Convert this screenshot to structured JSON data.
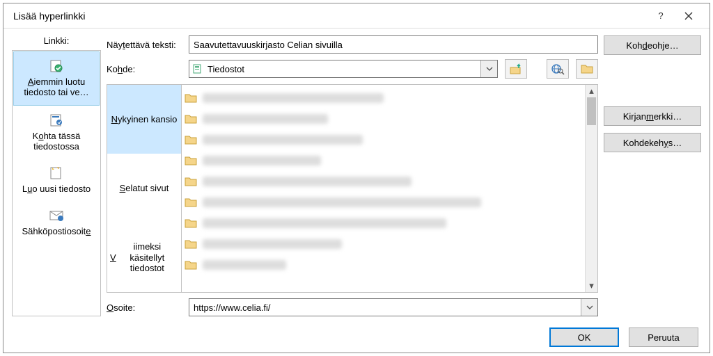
{
  "title": "Lisää hyperlinkki",
  "left": {
    "head": "Linkki:",
    "items": [
      {
        "label_html": "<u>A</u>iemmin luotu tiedosto tai ve…",
        "selected": true
      },
      {
        "label_html": "K<u>o</u>hta tässä tiedostossa",
        "selected": false
      },
      {
        "label_html": "L<u>u</u>o uusi tiedosto",
        "selected": false
      },
      {
        "label_html": "Sähköpostiosoit<u>e</u>",
        "selected": false
      }
    ]
  },
  "displaytext": {
    "label_html": "Näy<u>t</u>ettävä teksti:",
    "value": "Saavutettavuuskirjasto Celian sivuilla"
  },
  "kohde": {
    "label_html": "Ko<u>h</u>de:",
    "value": "Tiedostot"
  },
  "subtabs": [
    {
      "label_html": "<u>N</u>ykyinen kansio",
      "selected": true
    },
    {
      "label_html": "<u>S</u>elatut sivut",
      "selected": false
    },
    {
      "label_html": "<u>V</u>iimeksi käsitellyt tiedostot",
      "selected": false
    }
  ],
  "files_placeholder_widths": [
    260,
    180,
    230,
    170,
    300,
    400,
    350,
    200,
    120
  ],
  "osoite": {
    "label_html": "<u>O</u>soite:",
    "value": "https://www.celia.fi/"
  },
  "rightbuttons": {
    "kohdeohje_html": "Koh<u>d</u>eohje…",
    "kirjanmerkki_html": "Kirjan<u>m</u>erkki…",
    "kohdekehys_html": "Kohdekeh<u>y</u>s…"
  },
  "footer": {
    "ok": "OK",
    "cancel": "Peruuta"
  }
}
